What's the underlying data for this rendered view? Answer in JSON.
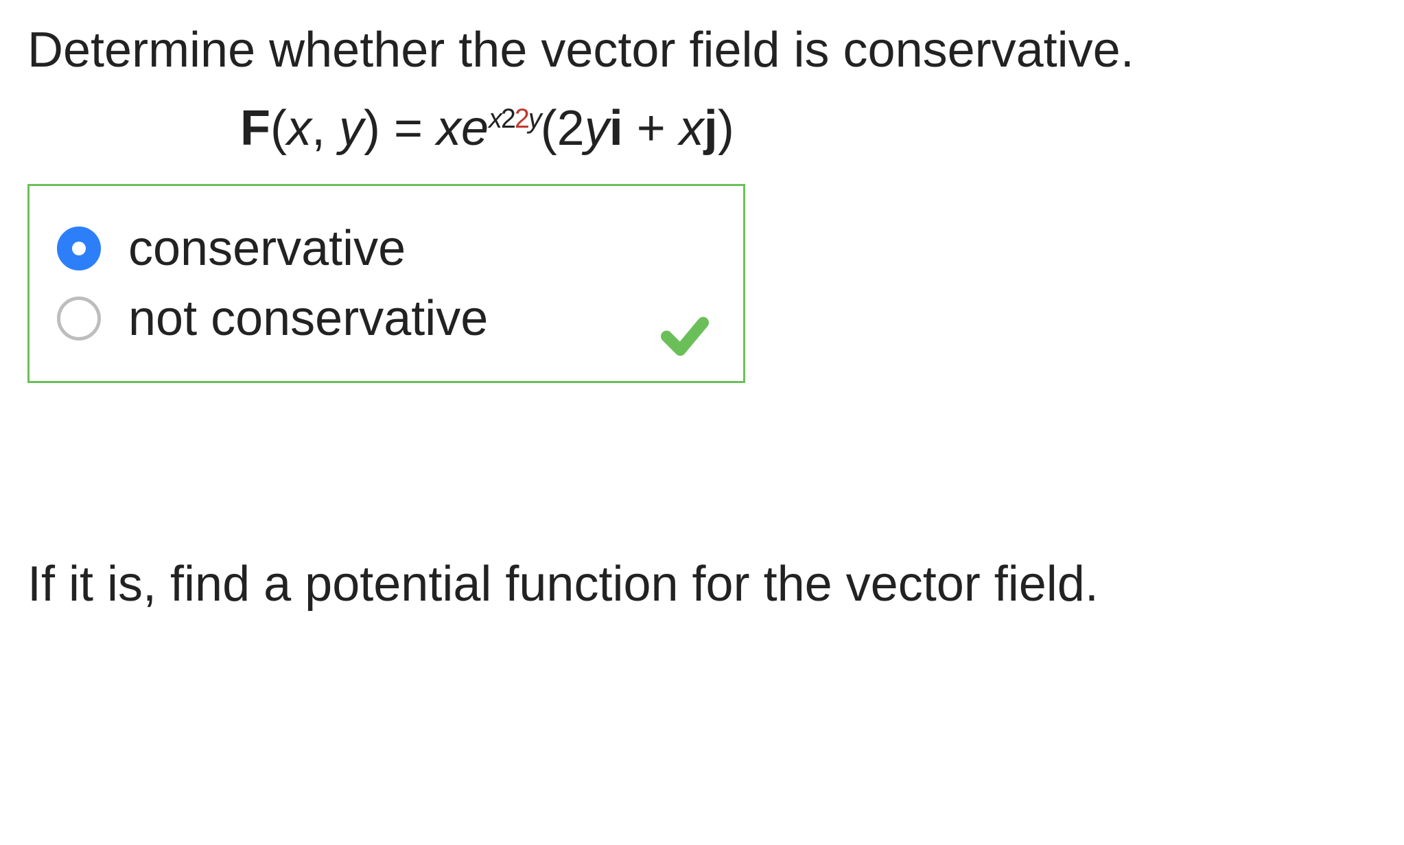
{
  "question": {
    "prompt": "Determine whether the vector field is conservative.",
    "formula": {
      "lhs_bold": "F",
      "lhs_args_open": "(",
      "lhs_x": "x",
      "lhs_comma": ", ",
      "lhs_y": "y",
      "lhs_args_close": ") = ",
      "coef_x": "x",
      "e": "e",
      "sup_x": "x",
      "sup_2a": "2",
      "sup_2b": "2",
      "sup_y": "y",
      "open": "(",
      "two": "2",
      "yi_y": "y",
      "yi_i": "i",
      "plus": " + ",
      "xj_x": "x",
      "xj_j": "j",
      "close": ")"
    },
    "options": [
      {
        "label": "conservative",
        "selected": true
      },
      {
        "label": "not conservative",
        "selected": false
      }
    ],
    "correct": true,
    "followup": "If it is, find a potential function for the vector field."
  }
}
